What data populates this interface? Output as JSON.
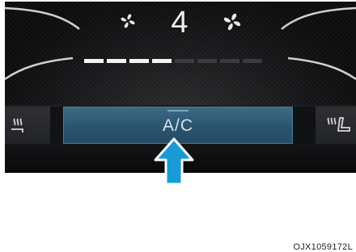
{
  "climate": {
    "fan_level": "4",
    "fan_bar": {
      "segments_total": 8,
      "segments_on": 4
    },
    "ac_label": "A/C",
    "accent_color": "#2b5470",
    "pointer_color": "#1a9ad6"
  },
  "caption": "OJX1059172L"
}
